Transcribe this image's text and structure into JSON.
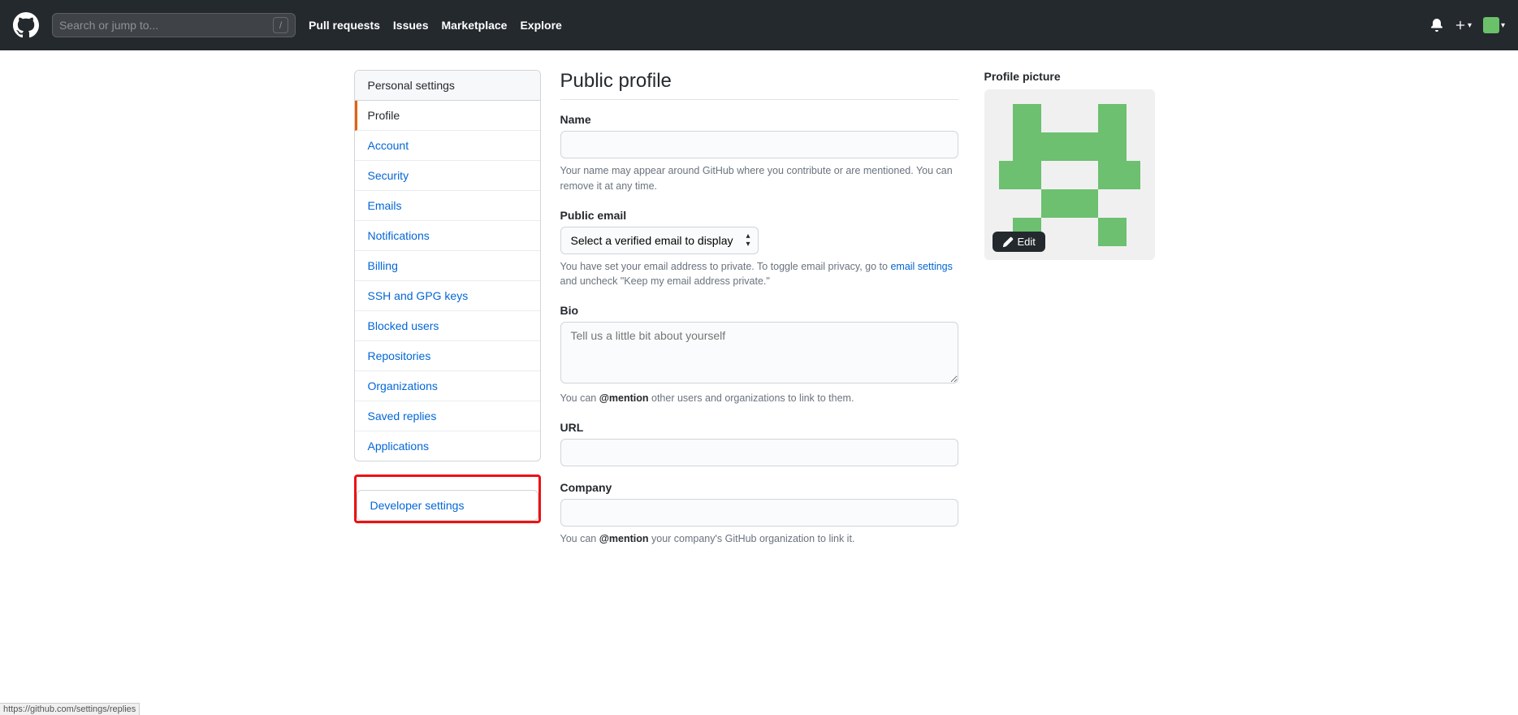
{
  "header": {
    "search_placeholder": "Search or jump to...",
    "slash": "/",
    "nav": [
      "Pull requests",
      "Issues",
      "Marketplace",
      "Explore"
    ]
  },
  "sidebar": {
    "header": "Personal settings",
    "items": [
      {
        "label": "Profile",
        "active": true
      },
      {
        "label": "Account"
      },
      {
        "label": "Security"
      },
      {
        "label": "Emails"
      },
      {
        "label": "Notifications"
      },
      {
        "label": "Billing"
      },
      {
        "label": "SSH and GPG keys"
      },
      {
        "label": "Blocked users"
      },
      {
        "label": "Repositories"
      },
      {
        "label": "Organizations"
      },
      {
        "label": "Saved replies"
      },
      {
        "label": "Applications"
      }
    ],
    "developer": "Developer settings"
  },
  "page": {
    "title": "Public profile",
    "name_label": "Name",
    "name_note": "Your name may appear around GitHub where you contribute or are mentioned. You can remove it at any time.",
    "email_label": "Public email",
    "email_select": "Select a verified email to display",
    "email_note1": "You have set your email address to private. To toggle email privacy, go to ",
    "email_link": "email settings",
    "email_note2": " and uncheck \"Keep my email address private.\"",
    "bio_label": "Bio",
    "bio_placeholder": "Tell us a little bit about yourself",
    "bio_note1": "You can ",
    "bio_mention": "@mention",
    "bio_note2": " other users and organizations to link to them.",
    "url_label": "URL",
    "company_label": "Company",
    "company_note1": "You can ",
    "company_mention": "@mention",
    "company_note2": " your company's GitHub organization to link it."
  },
  "picture": {
    "title": "Profile picture",
    "edit": "Edit"
  },
  "status": "https://github.com/settings/replies"
}
